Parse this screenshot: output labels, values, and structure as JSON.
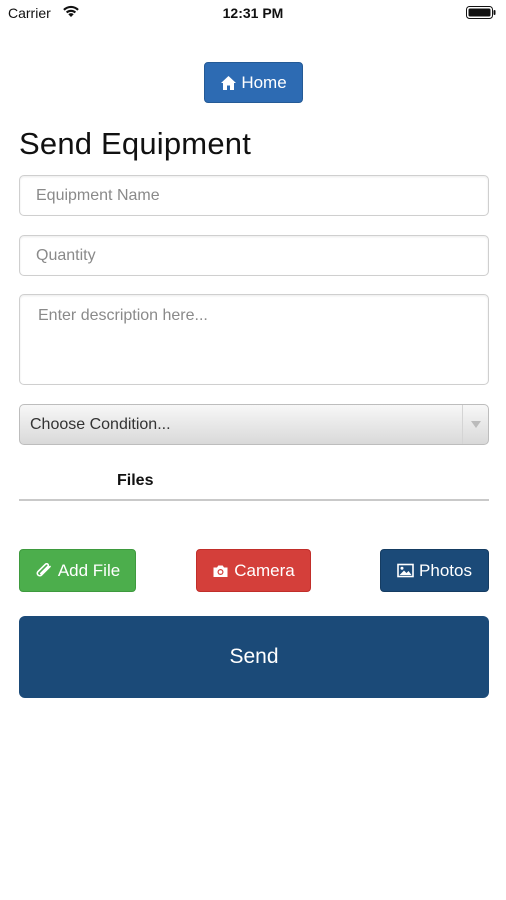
{
  "status_bar": {
    "carrier": "Carrier",
    "time": "12:31 PM"
  },
  "nav": {
    "home_label": "Home"
  },
  "page": {
    "title": "Send Equipment"
  },
  "form": {
    "equipment_name_placeholder": "Equipment Name",
    "quantity_placeholder": "Quantity",
    "description_placeholder": "Enter description here...",
    "condition_selected": "Choose Condition..."
  },
  "files": {
    "label": "Files"
  },
  "actions": {
    "add_file_label": "Add File",
    "camera_label": "Camera",
    "photos_label": "Photos",
    "send_label": "Send"
  },
  "icons": {
    "home": "home-icon",
    "add_file": "paperclip-icon",
    "camera": "camera-icon",
    "photos": "picture-icon",
    "select": "chevron-down-icon"
  },
  "colors": {
    "home_button": "#2d6bb3",
    "add_file_button": "#4cae4c",
    "camera_button": "#d43f3a",
    "photos_button": "#1b4a78",
    "send_button": "#1b4a78"
  }
}
